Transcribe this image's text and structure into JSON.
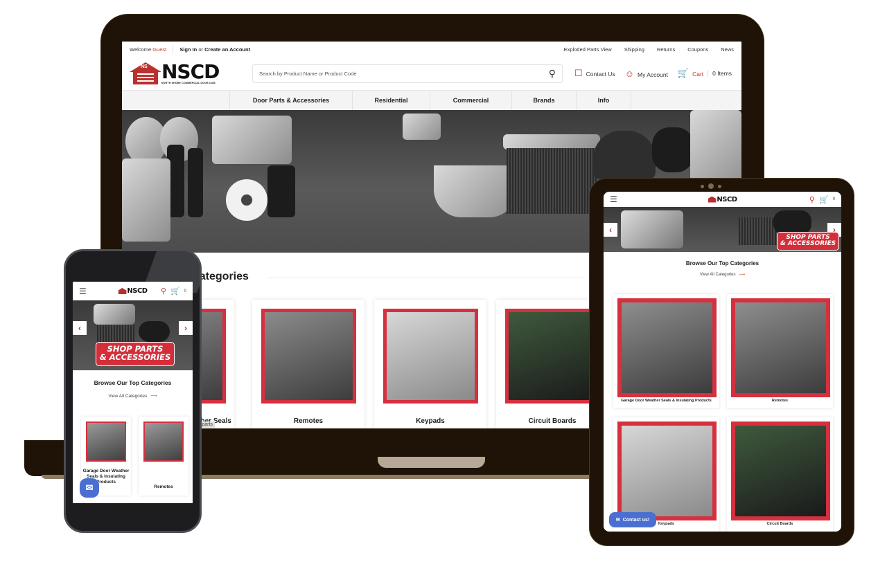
{
  "desktop": {
    "topbar": {
      "welcome": "Welcome",
      "guest": "Guest",
      "sign_in": "Sign In",
      "or": "or",
      "create_account": "Create an Account",
      "links": [
        "Exploded Parts View",
        "Shipping",
        "Returns",
        "Coupons",
        "News"
      ]
    },
    "logo": {
      "mark": "NS",
      "name": "NSCD",
      "tagline": "NORTH SHORE COMMERCIAL DOOR.COM"
    },
    "search": {
      "placeholder": "Search by Product Name or Product Code",
      "icon": "search-icon"
    },
    "header_links": {
      "contact": "Contact Us",
      "account": "My Account",
      "cart": "Cart",
      "cart_items": "0 Items"
    },
    "nav": [
      "Door Parts & Accessories",
      "Residential",
      "Commercial",
      "Brands",
      "Info"
    ],
    "categories": {
      "title": "Browse Our Top Categories",
      "title_visible": "p Categories",
      "cards": [
        {
          "label": "Garage Door Weather Seals & Insulating Products",
          "visible_label": "her Seals"
        },
        {
          "label": "Remotes"
        },
        {
          "label": "Keypads"
        },
        {
          "label": "Circuit Boards"
        }
      ],
      "tag": "-parts"
    }
  },
  "tablet": {
    "logo": "NSCD",
    "cart_count": "0",
    "hero_badge": [
      "SHOP PARTS",
      "& ACCESSORIES"
    ],
    "browse_title": "Browse Our Top Categories",
    "view_all": "View All Categories",
    "cards": [
      {
        "label": "Garage Door Weather Seals & Insulating Products"
      },
      {
        "label": "Remotes"
      },
      {
        "label": "Keypads"
      },
      {
        "label": "Circuit Boards"
      }
    ],
    "contact_button": "Contact us!"
  },
  "phone": {
    "logo": "NSCD",
    "cart_count": "0",
    "hero_badge": [
      "SHOP PARTS",
      "& ACCESSORIES"
    ],
    "browse_title": "Browse Our Top Categories",
    "view_all": "View All Categories",
    "cards": [
      {
        "label": "Garage Door Weather Seals & Insulating Products"
      },
      {
        "label": "Remotes"
      }
    ]
  },
  "colors": {
    "brand_red": "#b8312f",
    "card_red": "#d6303f",
    "frame": "#1e1306",
    "contact_blue": "#4a6fd1"
  }
}
